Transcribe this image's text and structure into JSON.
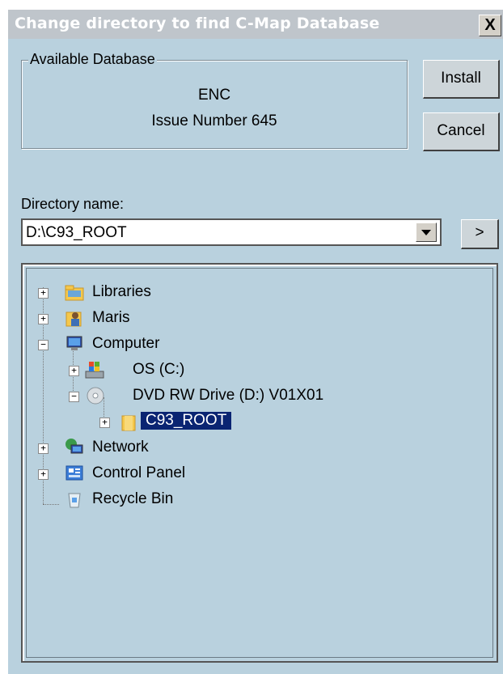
{
  "window": {
    "title": "Change directory to find C-Map Database",
    "close_glyph": "X"
  },
  "database_group": {
    "label": "Available Database",
    "name": "ENC",
    "issue": "Issue Number 645"
  },
  "buttons": {
    "install": "Install",
    "cancel": "Cancel",
    "go": ">"
  },
  "directory": {
    "label": "Directory name:",
    "value": "D:\\C93_ROOT"
  },
  "tree": {
    "libraries": "Libraries",
    "maris": "Maris",
    "computer": "Computer",
    "os_drive": "OS (C:)",
    "dvd_drive": "DVD RW Drive (D:) V01X01",
    "c93_root": "C93_ROOT",
    "network": "Network",
    "control_panel": "Control Panel",
    "recycle_bin": "Recycle Bin"
  }
}
